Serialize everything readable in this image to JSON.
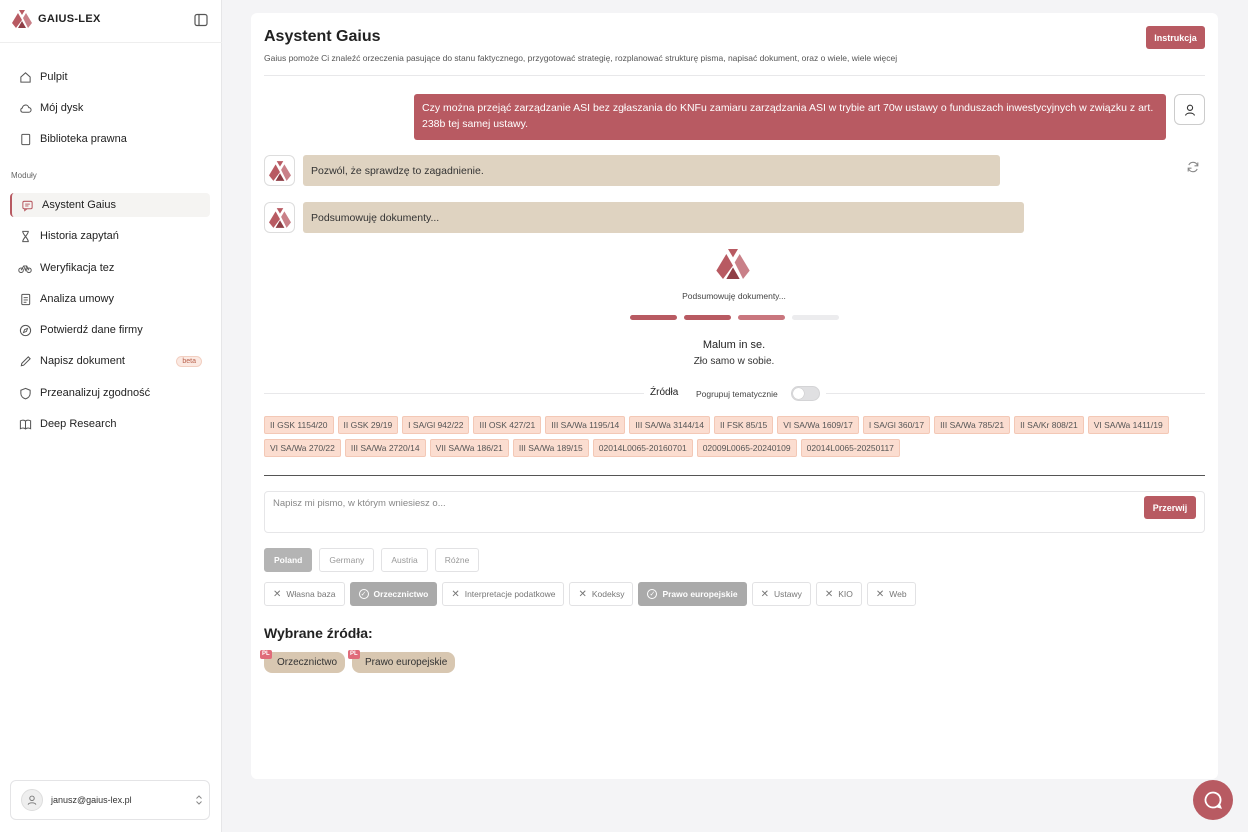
{
  "brand": {
    "name": "GAIUS-LEX"
  },
  "sidebar": {
    "nav": [
      {
        "label": "Pulpit",
        "icon": "home-icon"
      },
      {
        "label": "Mój dysk",
        "icon": "cloud-icon"
      },
      {
        "label": "Biblioteka prawna",
        "icon": "book-icon"
      }
    ],
    "section_label": "Moduły",
    "modules": [
      {
        "label": "Asystent Gaius",
        "icon": "chat-icon",
        "active": true
      },
      {
        "label": "Historia zapytań",
        "icon": "hourglass-icon"
      },
      {
        "label": "Weryfikacja tez",
        "icon": "bike-icon"
      },
      {
        "label": "Analiza umowy",
        "icon": "document-icon"
      },
      {
        "label": "Potwierdź dane firmy",
        "icon": "compass-icon"
      },
      {
        "label": "Napisz dokument",
        "icon": "pen-icon",
        "badge": "beta"
      },
      {
        "label": "Przeanalizuj zgodność",
        "icon": "shield-icon"
      },
      {
        "label": "Deep Research",
        "icon": "open-book-icon"
      }
    ],
    "user_email": "janusz@gaius-lex.pl"
  },
  "header": {
    "title": "Asystent Gaius",
    "subtitle": "Gaius pomoże Ci znaleźć orzeczenia pasujące do stanu faktycznego, przygotować strategię, rozplanować strukturę pisma, napisać dokument, oraz o wiele, wiele więcej",
    "instr_label": "Instrukcja"
  },
  "chat": {
    "user_message": "Czy można przejąć zarządzanie ASI bez zgłaszania do KNFu zamiaru zarządzania ASI w trybie art 70w ustawy o funduszach inwestycyjnych w związku z art. 238b tej samej ustawy.",
    "bot_messages": [
      "Pozwól, że sprawdzę to zagadnienie.",
      "Podsumowuję dokumenty..."
    ],
    "progress_label": "Podsumowuję dokumenty...",
    "progress": {
      "steps_total": 4,
      "steps_done": 3
    },
    "quote": "Malum in se.",
    "quote_sub": "Zło samo w sobie."
  },
  "sources": {
    "title": "Źródła",
    "group_label": "Pogrupuj tematycznie",
    "group_enabled": false,
    "chips": [
      "II GSK 1154/20",
      "II GSK 29/19",
      "I SA/Gl 942/22",
      "III OSK 427/21",
      "III SA/Wa 1195/14",
      "III SA/Wa 3144/14",
      "II FSK 85/15",
      "VI SA/Wa 1609/17",
      "I SA/Gl 360/17",
      "III SA/Wa 785/21",
      "II SA/Kr 808/21",
      "VI SA/Wa 1411/19",
      "VI SA/Wa 270/22",
      "III SA/Wa 2720/14",
      "VII SA/Wa 186/21",
      "III SA/Wa 189/15",
      "02014L0065-20160701",
      "02009L0065-20240109",
      "02014L0065-20250117"
    ]
  },
  "composer": {
    "placeholder": "Napisz mi pismo, w którym wniesiesz o...",
    "stop_label": "Przerwij"
  },
  "countries": [
    {
      "label": "Poland",
      "active": true
    },
    {
      "label": "Germany"
    },
    {
      "label": "Austria"
    },
    {
      "label": "Różne"
    }
  ],
  "filters": [
    {
      "label": "Własna baza",
      "active": false
    },
    {
      "label": "Orzecznictwo",
      "active": true
    },
    {
      "label": "Interpretacje podatkowe",
      "active": false
    },
    {
      "label": "Kodeksy",
      "active": false
    },
    {
      "label": "Prawo europejskie",
      "active": true
    },
    {
      "label": "Ustawy",
      "active": false
    },
    {
      "label": "KIO",
      "active": false
    },
    {
      "label": "Web",
      "active": false
    }
  ],
  "selected": {
    "title": "Wybrane źródła:",
    "items": [
      {
        "label": "Orzecznictwo",
        "tag": "PL"
      },
      {
        "label": "Prawo europejskie",
        "tag": "PL"
      }
    ]
  },
  "colors": {
    "accent": "#b85a62",
    "bot_bubble": "#dfd3c1",
    "chip_bg": "#fbddd0"
  }
}
